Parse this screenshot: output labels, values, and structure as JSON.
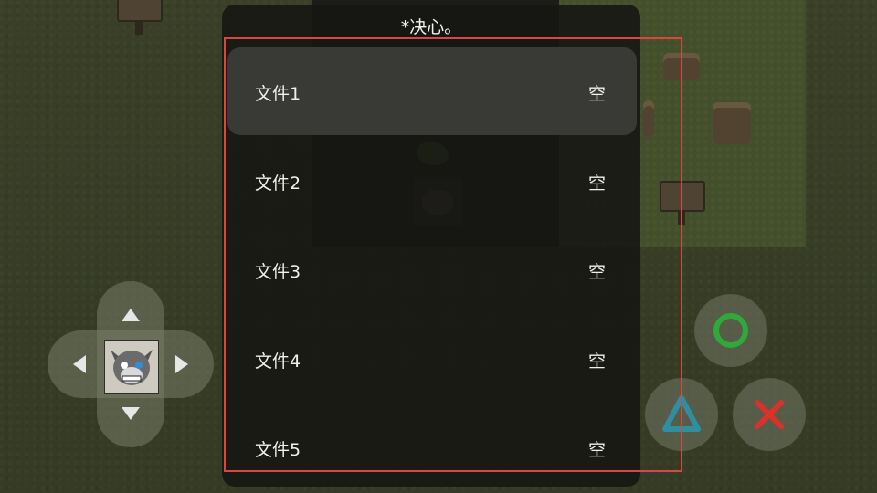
{
  "menu": {
    "title": "*决心。",
    "slots": [
      {
        "label": "文件1",
        "value": "空",
        "selected": true
      },
      {
        "label": "文件2",
        "value": "空",
        "selected": false
      },
      {
        "label": "文件3",
        "value": "空",
        "selected": false
      },
      {
        "label": "文件4",
        "value": "空",
        "selected": false
      },
      {
        "label": "文件5",
        "value": "空",
        "selected": false
      }
    ]
  },
  "controls": {
    "dpad_icons": [
      "arrow-up-icon",
      "arrow-down-icon",
      "arrow-left-icon",
      "arrow-right-icon"
    ],
    "buttons": [
      {
        "icon": "circle-icon",
        "color": "#2faa3a"
      },
      {
        "icon": "triangle-icon",
        "color": "#2e8fa3"
      },
      {
        "icon": "cross-icon",
        "color": "#d8322a"
      }
    ]
  },
  "colors": {
    "focus_outline": "#e0453d",
    "grass": "#4d5634",
    "menu_bg": "#161612"
  }
}
